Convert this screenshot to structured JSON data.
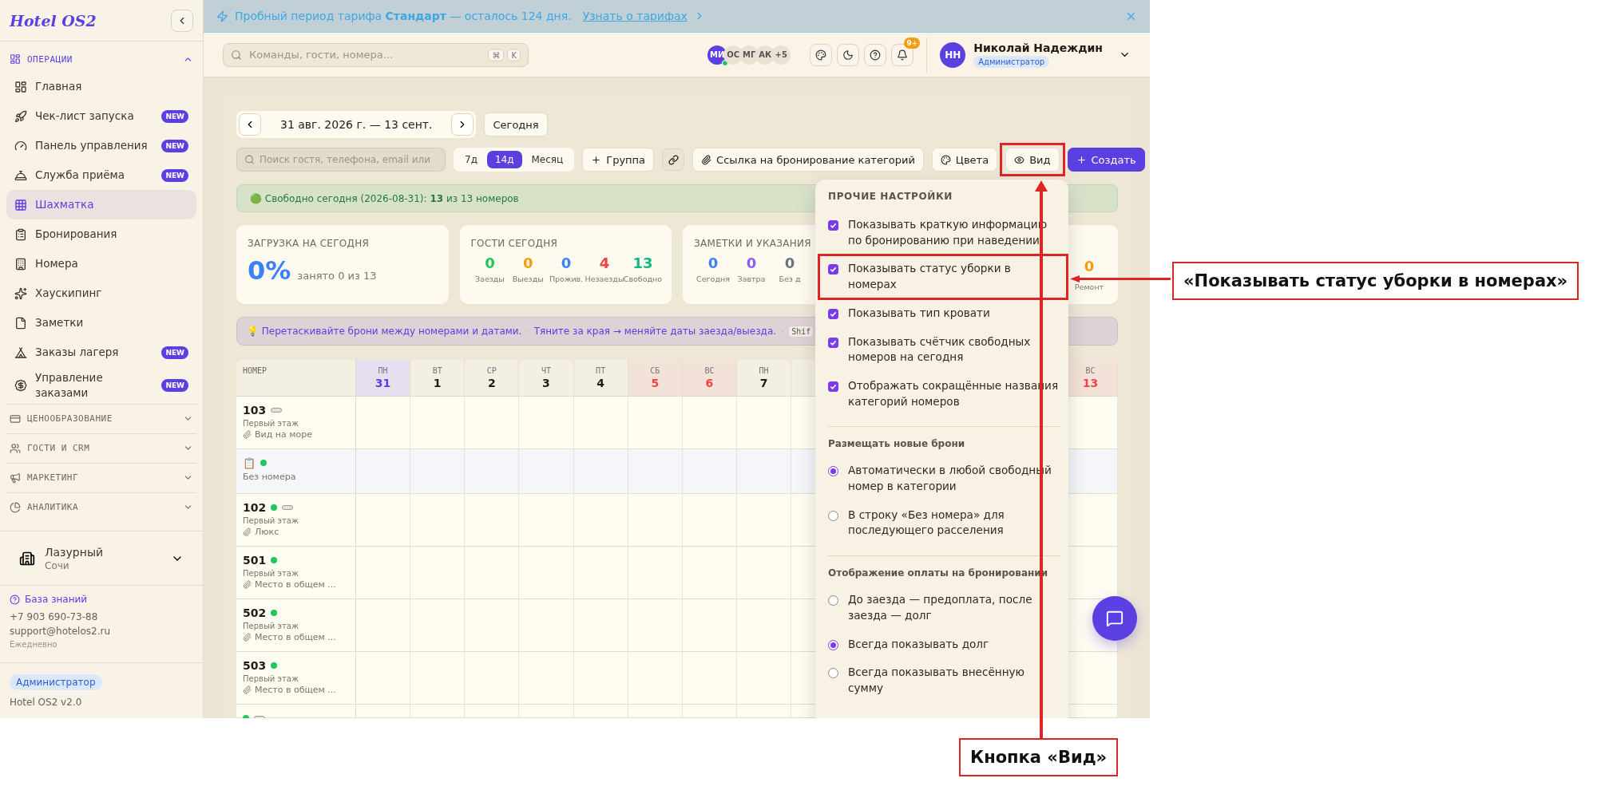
{
  "sidebar": {
    "logo": "Hotel OS2",
    "sections": [
      {
        "label": "ОПЕРАЦИИ",
        "expanded": true,
        "items": [
          {
            "label": "Главная",
            "selected": false
          },
          {
            "label": "Чек-лист запуска",
            "badge": "NEW",
            "selected": false
          },
          {
            "label": "Панель управления",
            "badge": "NEW",
            "selected": false
          },
          {
            "label": "Служба приёма",
            "badge": "NEW",
            "selected": false
          },
          {
            "label": "Шахматка",
            "selected": true
          },
          {
            "label": "Бронирования",
            "selected": false
          },
          {
            "label": "Номера",
            "selected": false
          },
          {
            "label": "Хаускипинг",
            "selected": false
          },
          {
            "label": "Заметки",
            "selected": false
          },
          {
            "label": "Заказы лагеря",
            "badge": "NEW",
            "selected": false
          },
          {
            "label": "Управление заказами",
            "badge": "NEW",
            "selected": false
          }
        ]
      },
      {
        "label": "ЦЕНООБРАЗОВАНИЕ",
        "expanded": false
      },
      {
        "label": "ГОСТИ И CRM",
        "expanded": false
      },
      {
        "label": "МАРКЕТИНГ",
        "expanded": false
      },
      {
        "label": "АНАЛИТИКА",
        "expanded": false
      }
    ],
    "property": {
      "name": "Лазурный",
      "city": "Сочи"
    },
    "help": {
      "link": "База знаний",
      "phone": "+7 903 690-73-88",
      "email": "support@hotelos2.ru",
      "hours": "Ежедневно"
    },
    "role": "Администратор",
    "version": "Hotel OS2 v2.0"
  },
  "banner": {
    "text": "Пробный период тарифа **Стандарт** — осталось 124 дня.",
    "link": "Узнать о тарифах"
  },
  "header": {
    "search": {
      "placeholder": "Команды, гости, номера...",
      "shortcut": [
        "⌘",
        "K"
      ]
    },
    "avatars": [
      {
        "initials": "МИ",
        "online": true
      },
      {
        "initials": "ОС",
        "online": false
      },
      {
        "initials": "МГ",
        "online": false
      },
      {
        "initials": "АК",
        "online": false
      }
    ],
    "more_avatars": "+5",
    "notifications": "9+",
    "user": {
      "initials": "НН",
      "name": "Николай Надеждин",
      "role": "Администратор"
    }
  },
  "toolbar": {
    "range": "31 авг. 2026 г. — 13 сент.",
    "today": "Сегодня",
    "search": {
      "placeholder": "Поиск гостя, телефона, email или"
    },
    "periods": [
      {
        "label": "7д",
        "selected": false
      },
      {
        "label": "14д",
        "selected": true
      },
      {
        "label": "Месяц",
        "selected": false
      }
    ],
    "group": "Группа",
    "booking_link": "Ссылка на бронирование категорий",
    "colors": "Цвета",
    "view": "Вид",
    "view_highlighted": true,
    "create": "Создать"
  },
  "free_today": "🟢 Свободно сегодня (2026-08-31): **13** из 13 номеров",
  "stats": [
    {
      "title": "ЗАГРУЗКА НА СЕГОДНЯ",
      "big": "0%",
      "note": "занято 0 из 13"
    },
    {
      "title": "ГОСТИ СЕГОДНЯ",
      "items": [
        {
          "value": "0",
          "label": "Заезды",
          "color": "#22c55e"
        },
        {
          "value": "0",
          "label": "Выезды",
          "color": "#f59e0b"
        },
        {
          "value": "0",
          "label": "Прожив.",
          "color": "#3b82f6"
        },
        {
          "value": "4",
          "label": "Незаезды",
          "color": "#ef4444"
        },
        {
          "value": "13",
          "label": "Свободно",
          "color": "#10b981"
        }
      ]
    },
    {
      "title": "ЗАМЕТКИ И УКАЗАНИЯ",
      "items": [
        {
          "value": "0",
          "label": "Сегодня",
          "color": "#3b82f6"
        },
        {
          "value": "0",
          "label": "Завтра",
          "color": "#8b5cf6"
        },
        {
          "value": "0",
          "label": "Без д",
          "color": "#6b7280"
        }
      ]
    },
    {
      "items": [
        {
          "value": "0",
          "label": "Ремонт",
          "color": "#f59e0b"
        }
      ]
    }
  ],
  "hint": {
    "parts": [
      {
        "kind": "text",
        "text": "💡 Перетаскивайте брони между номерами и датами."
      },
      {
        "kind": "separator",
        "text": "·"
      },
      {
        "kind": "text",
        "text": "Тяните за края → меняйте даты заезда/выезда."
      },
      {
        "kind": "separator",
        "text": "·"
      },
      {
        "kind": "key",
        "text": "Shif"
      }
    ]
  },
  "calendar": {
    "room_header": "НОМЕР",
    "days": [
      {
        "dow": "ПН",
        "day": "31",
        "today": true,
        "weekend": false
      },
      {
        "dow": "ВТ",
        "day": "1",
        "today": false,
        "weekend": false
      },
      {
        "dow": "СР",
        "day": "2",
        "today": false,
        "weekend": false
      },
      {
        "dow": "ЧТ",
        "day": "3",
        "today": false,
        "weekend": false
      },
      {
        "dow": "ПТ",
        "day": "4",
        "today": false,
        "weekend": false
      },
      {
        "dow": "СБ",
        "day": "5",
        "today": false,
        "weekend": true
      },
      {
        "dow": "ВС",
        "day": "6",
        "today": false,
        "weekend": true
      },
      {
        "dow": "ПН",
        "day": "7",
        "today": false,
        "weekend": false
      },
      {
        "kind": "covered_span"
      },
      {
        "dow": "ВС",
        "day": "13",
        "today": false,
        "weekend": true
      }
    ],
    "rooms": [
      {
        "kind": "room",
        "number": "103",
        "bed_tag": true,
        "floor": "Первый этаж",
        "category": "Вид на море"
      },
      {
        "kind": "unassigned",
        "icon": "📋",
        "color": "#22c55e",
        "label": "Без номера"
      },
      {
        "kind": "room",
        "number": "102",
        "color": "#22c55e",
        "bed_tag": true,
        "floor": "Первый этаж",
        "category": "Люкс"
      },
      {
        "kind": "room",
        "number": "501",
        "color": "#22c55e",
        "bed_tag": false,
        "floor": "Первый этаж",
        "category": "Место в общем ..."
      },
      {
        "kind": "room",
        "number": "502",
        "color": "#22c55e",
        "bed_tag": false,
        "floor": "Первый этаж",
        "category": "Место в общем ..."
      },
      {
        "kind": "room",
        "number": "503",
        "color": "#22c55e",
        "bed_tag": false,
        "floor": "Первый этаж",
        "category": "Место в общем ..."
      },
      {
        "kind": "room",
        "color": "#22c55e",
        "bed_tag": true
      }
    ]
  },
  "view_menu": {
    "title": "ПРОЧИЕ НАСТРОЙКИ",
    "options": [
      {
        "label": "Показывать краткую информацию по бронированию при наведении",
        "checked": true,
        "highlighted": false
      },
      {
        "label": "Показывать статус уборки в номерах",
        "checked": true,
        "highlighted": true
      },
      {
        "label": "Показывать тип кровати",
        "checked": true,
        "highlighted": false
      },
      {
        "label": "Показывать счётчик свободных номеров на сегодня",
        "checked": true,
        "highlighted": false
      },
      {
        "label": "Отображать сокращённые названия категорий номеров",
        "checked": true,
        "highlighted": false
      }
    ],
    "groups": [
      {
        "title": "Размещать новые брони",
        "choices": [
          {
            "label": "Автоматически в любой свободный номер в категории",
            "selected": true
          },
          {
            "label": "В строку «Без номера» для последующего расселения",
            "selected": false
          }
        ]
      },
      {
        "title": "Отображение оплаты на бронировании",
        "choices": [
          {
            "label": "До заезда — предоплата, после заезда — долг",
            "selected": false
          },
          {
            "label": "Всегда показывать долг",
            "selected": true
          },
          {
            "label": "Всегда показывать внесённую сумму",
            "selected": false
          }
        ]
      }
    ]
  },
  "annotations": [
    {
      "kind": "row",
      "label": "«Показывать статус уборки в номерах»"
    },
    {
      "kind": "button",
      "label": "Кнопка «Вид»"
    }
  ]
}
